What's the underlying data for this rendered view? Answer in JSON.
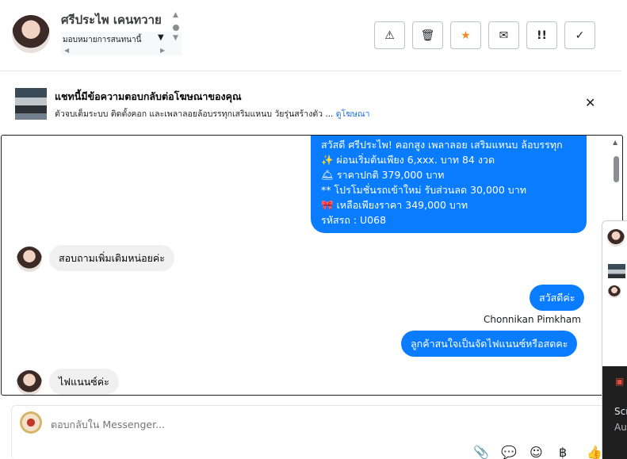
{
  "header": {
    "contact_name": "ศรีประไพ เคนทวาย",
    "assign_label": "มอบหมายการสนทนานี้",
    "toolbar": {
      "report_icon": "⚠",
      "delete_icon": "🗑",
      "star_icon": "★",
      "unread_icon": "✉",
      "priority_icon": "!!",
      "done_icon": "✓"
    }
  },
  "ad_banner": {
    "title": "แชทนี้มีข้อความตอบกลับต่อโฆษณาของคุณ",
    "description": "ตัวจบเต็มระบบ ติดตั้งคอก และเพลาลอยล้อบรรทุกเสริมแหนบ วัยรุ่นสร้างตัว ...",
    "link_label": "ดูโฆษณา",
    "close_icon": "✕"
  },
  "messages": {
    "big_outgoing": [
      "สวัสดี ศรีประไพ! คอกสูง เพลาลอย เสริมแหนบ ล้อบรรทุก",
      "✨ ผ่อนเริ่มต้นเพียง 6,xxx. บาท 84 งวด",
      "🛎 ราคาปกติ 379,000 บาท",
      "** โปรโมชั่นรถเข้าใหม่ รับส่วนลด 30,000 บาท",
      "🎀 เหลือเพียงราคา 349,000 บาท",
      "รหัสรถ : U068"
    ],
    "incoming_1": "สอบถามเพิ่มเติมหน่อยค่ะ",
    "outgoing_hello": "สวัสดีค่ะ",
    "sender_name": "Chonnikan Pimkham",
    "outgoing_question": "ลูกค้าสนใจเป็นจัดไฟแนนซ์หรือสดคะ",
    "incoming_2": "ไฟแนนซ์ค่ะ"
  },
  "composer": {
    "placeholder": "ตอบกลับใน Messenger...",
    "icons": {
      "attach": "📎",
      "reply": "💬",
      "emoji": "☺",
      "payment": "฿",
      "like": "👍"
    }
  },
  "overlay": {
    "text1": "Scr",
    "text2": "Au"
  },
  "colors": {
    "accent": "#0a7cff",
    "incoming_bubble": "#f0f0f0",
    "star": "#f28c28",
    "link": "#216fdb"
  }
}
